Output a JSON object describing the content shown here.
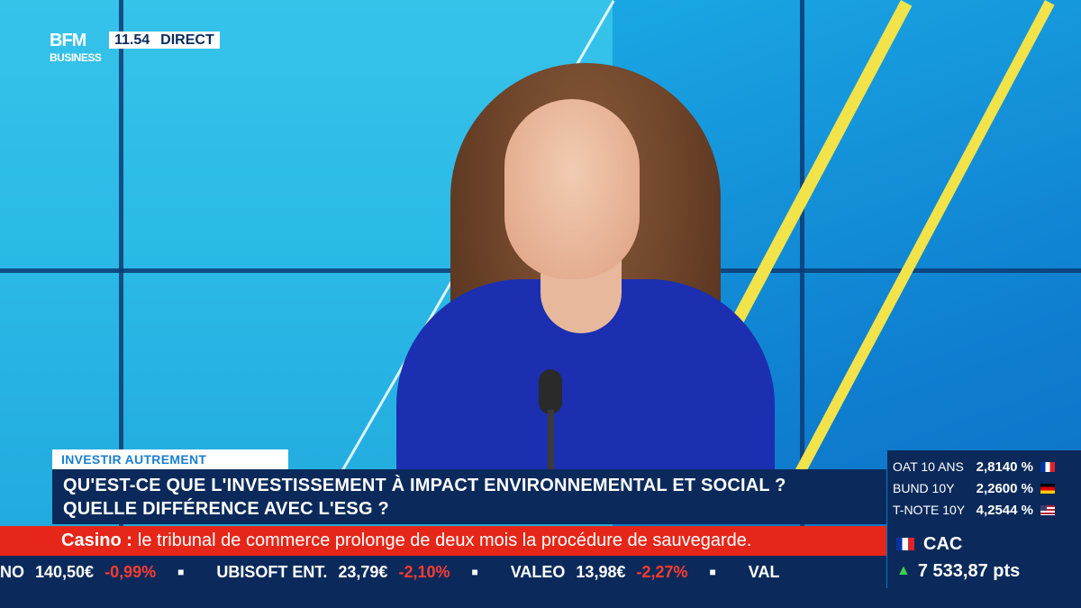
{
  "channel": {
    "logo_top": "BFM",
    "logo_bottom": "BUSINESS",
    "time": "11.54",
    "live_label": "DIRECT"
  },
  "lower_third": {
    "section": "INVESTIR AUTREMENT",
    "headline_line1": "QU'EST-CE QUE L'INVESTISSEMENT À IMPACT ENVIRONNEMENTAL ET SOCIAL ?",
    "headline_line2": "QUELLE DIFFÉRENCE AVEC L'ESG ?"
  },
  "breaking": {
    "keyword": "Casino :",
    "text": "le tribunal de commerce prolonge de deux mois la procédure de sauvegarde."
  },
  "ticker": [
    {
      "name": "NO",
      "value": "140,50€",
      "change": "-0,99%"
    },
    {
      "name": "UBISOFT ENT.",
      "value": "23,79€",
      "change": "-2,10%"
    },
    {
      "name": "VALEO",
      "value": "13,98€",
      "change": "-2,27%"
    },
    {
      "name": "VAL",
      "value": "",
      "change": ""
    }
  ],
  "rates": [
    {
      "name": "OAT 10 ANS",
      "value": "2,8140 %",
      "flag": "fr"
    },
    {
      "name": "BUND 10Y",
      "value": "2,2600 %",
      "flag": "de"
    },
    {
      "name": "T-NOTE 10Y",
      "value": "4,2544 %",
      "flag": "us"
    }
  ],
  "index": {
    "name": "CAC",
    "flag": "fr",
    "direction_icon": "triangle-up-icon",
    "value": "7 533,87 pts",
    "color_up": "#3bd24a"
  },
  "colors": {
    "navy": "#0b2a5b",
    "breaking_red": "#e52618",
    "accent_blue": "#1a7fd0",
    "negative": "#ff3b30"
  }
}
